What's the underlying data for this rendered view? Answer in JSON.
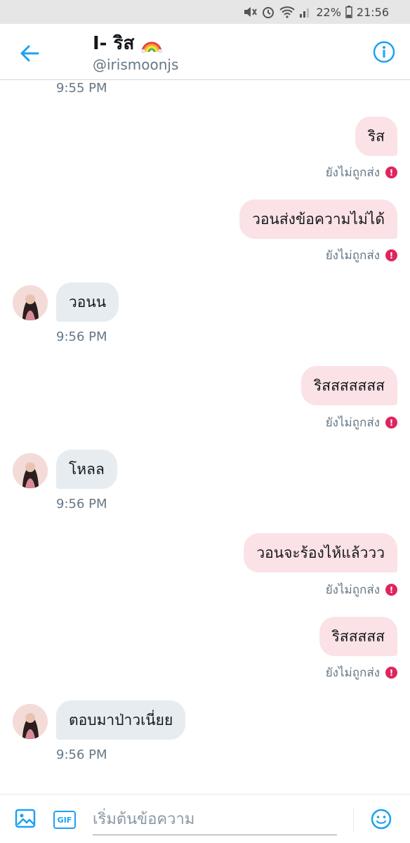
{
  "status_bar": {
    "battery": "22%",
    "time": "21:56"
  },
  "header": {
    "title": "I- ริส",
    "handle": "@irismoonjs"
  },
  "messages": [
    {
      "ts": "9:55 PM"
    },
    {
      "text": "ริส",
      "status": "ยังไม่ถูกส่ง"
    },
    {
      "text": "วอนส่งข้อความไม่ได้",
      "status": "ยังไม่ถูกส่ง"
    },
    {
      "text": "วอนน",
      "ts": "9:56 PM"
    },
    {
      "text": "ริสสสสสสส",
      "status": "ยังไม่ถูกส่ง"
    },
    {
      "text": "โหลล",
      "ts": "9:56 PM"
    },
    {
      "text": "วอนจะร้องไห้แล้ววว",
      "status": "ยังไม่ถูกส่ง"
    },
    {
      "text": "ริสสสสส",
      "status": "ยังไม่ถูกส่ง"
    },
    {
      "text": "ตอบมาป่าวเนี่ยย",
      "ts": "9:56 PM"
    }
  ],
  "composer": {
    "placeholder": "เริ่มต้นข้อความ",
    "gif_label": "GIF"
  },
  "colors": {
    "accent": "#1da1f2",
    "error": "#e0245e",
    "outgoing_bubble": "#fbe2e6",
    "incoming_bubble": "#e6ecf0"
  }
}
